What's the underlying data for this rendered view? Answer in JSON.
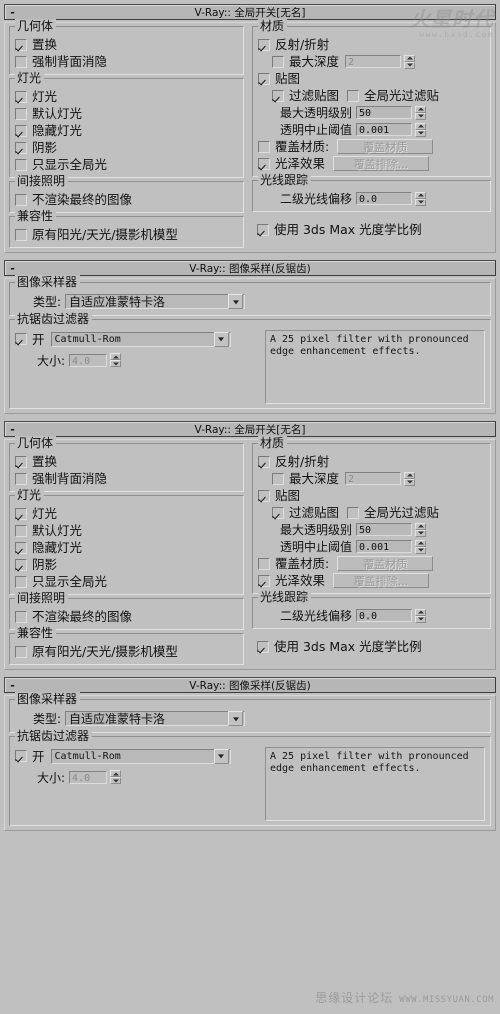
{
  "panels": [
    {
      "id": "global-switches-1",
      "title": "V-Ray:: 全局开关[无名]",
      "collapse_glyph": "-"
    },
    {
      "id": "image-sampler-1",
      "title": "V-Ray:: 图像采样(反锯齿)",
      "collapse_glyph": "-"
    },
    {
      "id": "global-switches-2",
      "title": "V-Ray:: 全局开关[无名]",
      "collapse_glyph": "-"
    },
    {
      "id": "image-sampler-2",
      "title": "V-Ray:: 图像采样(反锯齿)",
      "collapse_glyph": "-"
    }
  ],
  "global_switches": {
    "geometry": {
      "legend": "几何体",
      "displacement": {
        "label": "置换",
        "checked": true
      },
      "force_backface_cull": {
        "label": "强制背面消隐",
        "checked": false
      }
    },
    "lighting": {
      "legend": "灯光",
      "lights": {
        "label": "灯光",
        "checked": true
      },
      "default_lights": {
        "label": "默认灯光",
        "checked": false
      },
      "hidden_lights": {
        "label": "隐藏灯光",
        "checked": true
      },
      "shadows": {
        "label": "阴影",
        "checked": true
      },
      "show_gi_only": {
        "label": "只显示全局光",
        "checked": false
      }
    },
    "indirect_illumination": {
      "legend": "间接照明",
      "dont_render_final": {
        "label": "不渲染最终的图像",
        "checked": false
      }
    },
    "compatibility": {
      "legend": "兼容性",
      "legacy_sun_sky_camera": {
        "label": "原有阳光/天光/摄影机模型",
        "checked": false
      },
      "use_3dsmax_photometric": {
        "label": "使用 3ds Max 光度学比例",
        "checked": true
      }
    },
    "materials": {
      "legend": "材质",
      "reflection_refraction": {
        "label": "反射/折射",
        "checked": true
      },
      "max_depth": {
        "label": "最大深度",
        "checked": false,
        "value": "2",
        "disabled": true
      },
      "maps": {
        "label": "贴图",
        "checked": true
      },
      "filter_maps": {
        "label": "过滤贴图",
        "checked": true
      },
      "filter_maps_gi": {
        "label": "全局光过滤贴",
        "checked": false
      },
      "max_transp_levels": {
        "label": "最大透明级别",
        "value": "50"
      },
      "transp_cutoff": {
        "label": "透明中止阈值",
        "value": "0.001"
      },
      "override_mtl": {
        "label": "覆盖材质:",
        "checked": false,
        "button": "覆盖材质",
        "button_disabled": true
      },
      "glossy_effects": {
        "label": "光泽效果",
        "checked": true,
        "button": "覆盖排除...",
        "button_disabled": true
      }
    },
    "raytracing": {
      "legend": "光线跟踪",
      "secondary_ray_bias": {
        "label": "二级光线偏移",
        "value": "0.0"
      }
    }
  },
  "image_sampler": {
    "sampler_group": {
      "legend": "图像采样器",
      "type_label": "类型:",
      "type_value": "自适应准蒙特卡洛"
    },
    "aa_filter_group": {
      "legend": "抗锯齿过滤器",
      "on": {
        "label": "开",
        "checked": true
      },
      "filter_value": "Catmull-Rom",
      "size_label": "大小:",
      "size_value": "4.0",
      "size_disabled": true,
      "description": "A 25 pixel filter with pronounced edge enhancement effects."
    }
  },
  "watermarks": {
    "top": {
      "brand": "火星时代",
      "url": "www.hxsd.com"
    },
    "bottom": {
      "brand": "思缘设计论坛",
      "url": "WWW.MISSYUAN.COM"
    }
  }
}
